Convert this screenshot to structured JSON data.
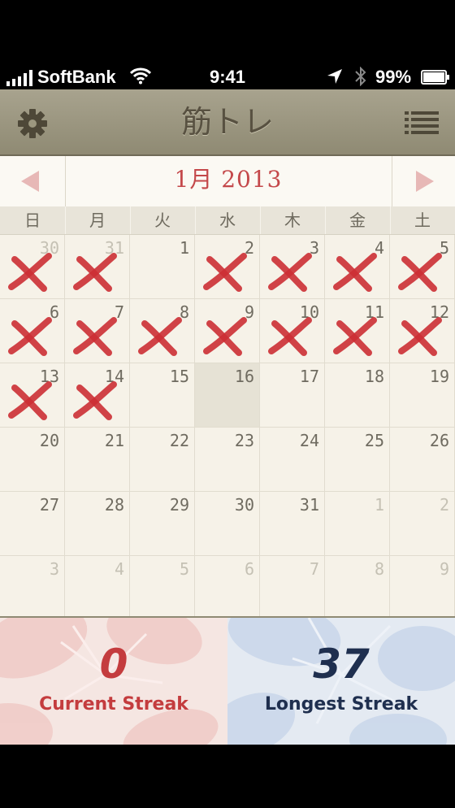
{
  "status_bar": {
    "carrier": "SoftBank",
    "time": "9:41",
    "battery": "99%"
  },
  "nav": {
    "title": "筋トレ",
    "settings_icon": "gear-icon",
    "list_icon": "list-icon"
  },
  "calendar": {
    "month_label": "1月 2013",
    "prev_icon": "triangle-left-icon",
    "next_icon": "triangle-right-icon",
    "weekdays": [
      "日",
      "月",
      "火",
      "水",
      "木",
      "金",
      "土"
    ],
    "weeks": [
      [
        {
          "d": "30",
          "dim": true,
          "x": true
        },
        {
          "d": "31",
          "dim": true,
          "x": true
        },
        {
          "d": "1"
        },
        {
          "d": "2",
          "x": true
        },
        {
          "d": "3",
          "x": true
        },
        {
          "d": "4",
          "x": true
        },
        {
          "d": "5",
          "x": true
        }
      ],
      [
        {
          "d": "6",
          "x": true
        },
        {
          "d": "7",
          "x": true
        },
        {
          "d": "8",
          "x": true
        },
        {
          "d": "9",
          "x": true
        },
        {
          "d": "10",
          "x": true
        },
        {
          "d": "11",
          "x": true
        },
        {
          "d": "12",
          "x": true
        }
      ],
      [
        {
          "d": "13",
          "x": true
        },
        {
          "d": "14",
          "x": true
        },
        {
          "d": "15"
        },
        {
          "d": "16",
          "today": true
        },
        {
          "d": "17"
        },
        {
          "d": "18"
        },
        {
          "d": "19"
        }
      ],
      [
        {
          "d": "20"
        },
        {
          "d": "21"
        },
        {
          "d": "22"
        },
        {
          "d": "23"
        },
        {
          "d": "24"
        },
        {
          "d": "25"
        },
        {
          "d": "26"
        }
      ],
      [
        {
          "d": "27"
        },
        {
          "d": "28"
        },
        {
          "d": "29"
        },
        {
          "d": "30"
        },
        {
          "d": "31"
        },
        {
          "d": "1",
          "dim": true
        },
        {
          "d": "2",
          "dim": true
        }
      ],
      [
        {
          "d": "3",
          "dim": true
        },
        {
          "d": "4",
          "dim": true
        },
        {
          "d": "5",
          "dim": true
        },
        {
          "d": "6",
          "dim": true
        },
        {
          "d": "7",
          "dim": true
        },
        {
          "d": "8",
          "dim": true
        },
        {
          "d": "9",
          "dim": true
        }
      ]
    ]
  },
  "streaks": {
    "current_value": "0",
    "current_label": "Current Streak",
    "longest_value": "37",
    "longest_label": "Longest Streak"
  },
  "colors": {
    "accent_red": "#c4484a",
    "mark_red": "#cc2f34",
    "longest_navy": "#1f2f4f",
    "nav_olive": "#9c977f"
  }
}
